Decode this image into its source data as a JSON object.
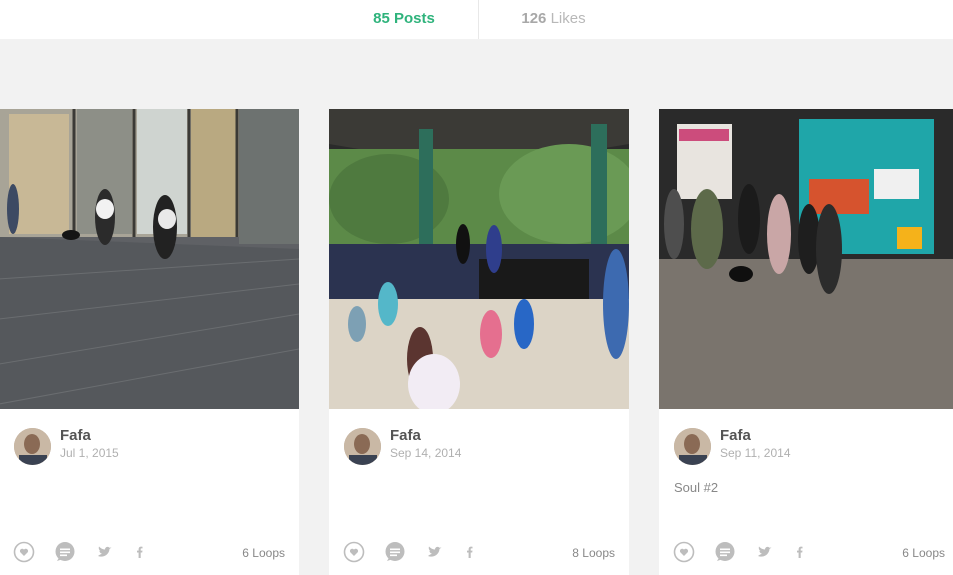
{
  "profile_stats": {
    "posts_count": "85",
    "posts_label": "Posts",
    "likes_count": "126",
    "likes_label": "Likes"
  },
  "colors": {
    "accent": "#2fb37c",
    "muted": "#a8a8a8"
  },
  "posts": [
    {
      "author": "Fafa",
      "date": "Jul 1, 2015",
      "caption": "",
      "loops": "6 Loops",
      "actions": [
        "like-icon",
        "comment-icon",
        "twitter-icon",
        "facebook-icon"
      ]
    },
    {
      "author": "Fafa",
      "date": "Sep 14, 2014",
      "caption": "",
      "loops": "8 Loops",
      "actions": [
        "like-icon",
        "comment-icon",
        "twitter-icon",
        "facebook-icon"
      ]
    },
    {
      "author": "Fafa",
      "date": "Sep 11, 2014",
      "caption": "Soul #2",
      "loops": "6 Loops",
      "actions": [
        "like-icon",
        "comment-icon",
        "twitter-icon",
        "facebook-icon"
      ]
    }
  ]
}
